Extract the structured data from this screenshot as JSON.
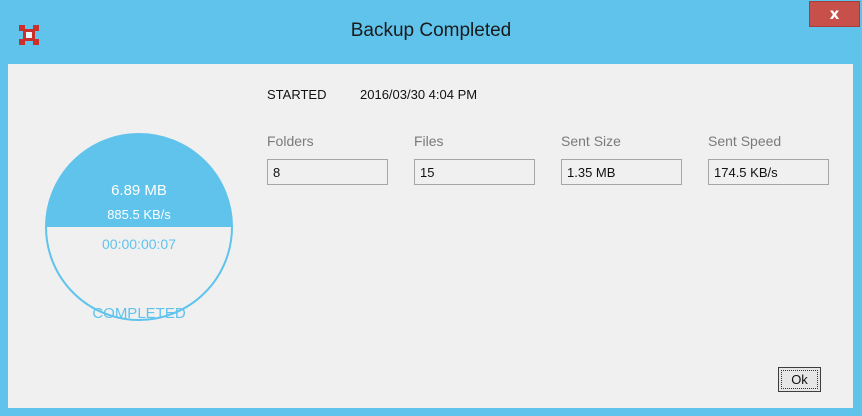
{
  "window": {
    "title": "Backup Completed",
    "close_label": "x"
  },
  "started": {
    "label": "STARTED",
    "value": "2016/03/30 4:04 PM"
  },
  "stats": {
    "folders": {
      "label": "Folders",
      "value": "8"
    },
    "files": {
      "label": "Files",
      "value": "15"
    },
    "sent_size": {
      "label": "Sent Size",
      "value": "1.35 MB"
    },
    "sent_speed": {
      "label": "Sent Speed",
      "value": "174.5 KB/s"
    }
  },
  "gauge": {
    "size": "6.89 MB",
    "speed": "885.5 KB/s",
    "elapsed": "00:00:00:07",
    "status": "COMPLETED"
  },
  "buttons": {
    "ok_label": "Ok"
  },
  "colors": {
    "accent": "#5fc3ec",
    "close_button": "#c7504a",
    "app_icon": "#c9302c",
    "background": "#f0f0f0"
  },
  "icons": {
    "app": "app-logo-icon",
    "close": "close-icon"
  }
}
